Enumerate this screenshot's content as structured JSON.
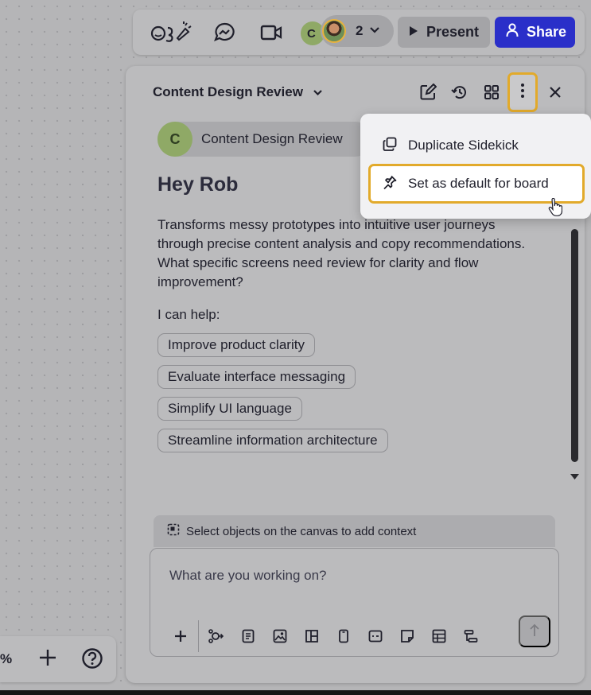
{
  "toolbar": {
    "reactions_icon": "reactions-icon",
    "chat_icon": "messenger-icon",
    "video_icon": "video-camera-icon",
    "avatar_initial": "C",
    "collaborator_count": "2",
    "present_label": "Present",
    "share_label": "Share",
    "share_color": "#2a2fc9"
  },
  "panel": {
    "title": "Content Design Review",
    "header_icons": [
      "edit-icon",
      "history-icon",
      "grid-icon",
      "more-vertical-icon",
      "close-icon"
    ],
    "agent": {
      "initial": "C",
      "name": "Content Design Review"
    },
    "greeting": "Hey Rob",
    "intro": "Transforms messy prototypes into intuitive user journeys through precise content analysis and copy recommendations. What specific screens need review for clarity and flow improvement?",
    "help_label": "I can help:",
    "suggestions": [
      "Improve product clarity",
      "Evaluate interface messaging",
      "Simplify UI language",
      "Streamline information architecture"
    ],
    "context_hint": "Select objects on the canvas to add context",
    "composer_placeholder": "What are you working on?",
    "composer_tools": [
      "plus-icon",
      "connect-icon",
      "document-icon",
      "image-icon",
      "layout-icon",
      "phone-frame-icon",
      "card-icon",
      "sticky-note-icon",
      "table-icon",
      "flowchart-icon"
    ]
  },
  "menu": {
    "items": [
      {
        "label": "Duplicate Sidekick",
        "icon": "duplicate-icon"
      },
      {
        "label": "Set as default for board",
        "icon": "pin-icon"
      }
    ],
    "highlight_color": "#e2aa2b"
  },
  "bottom_bar": {
    "zoom_text": "%",
    "add_icon": "plus-icon",
    "help_icon": "help-circle-icon"
  }
}
